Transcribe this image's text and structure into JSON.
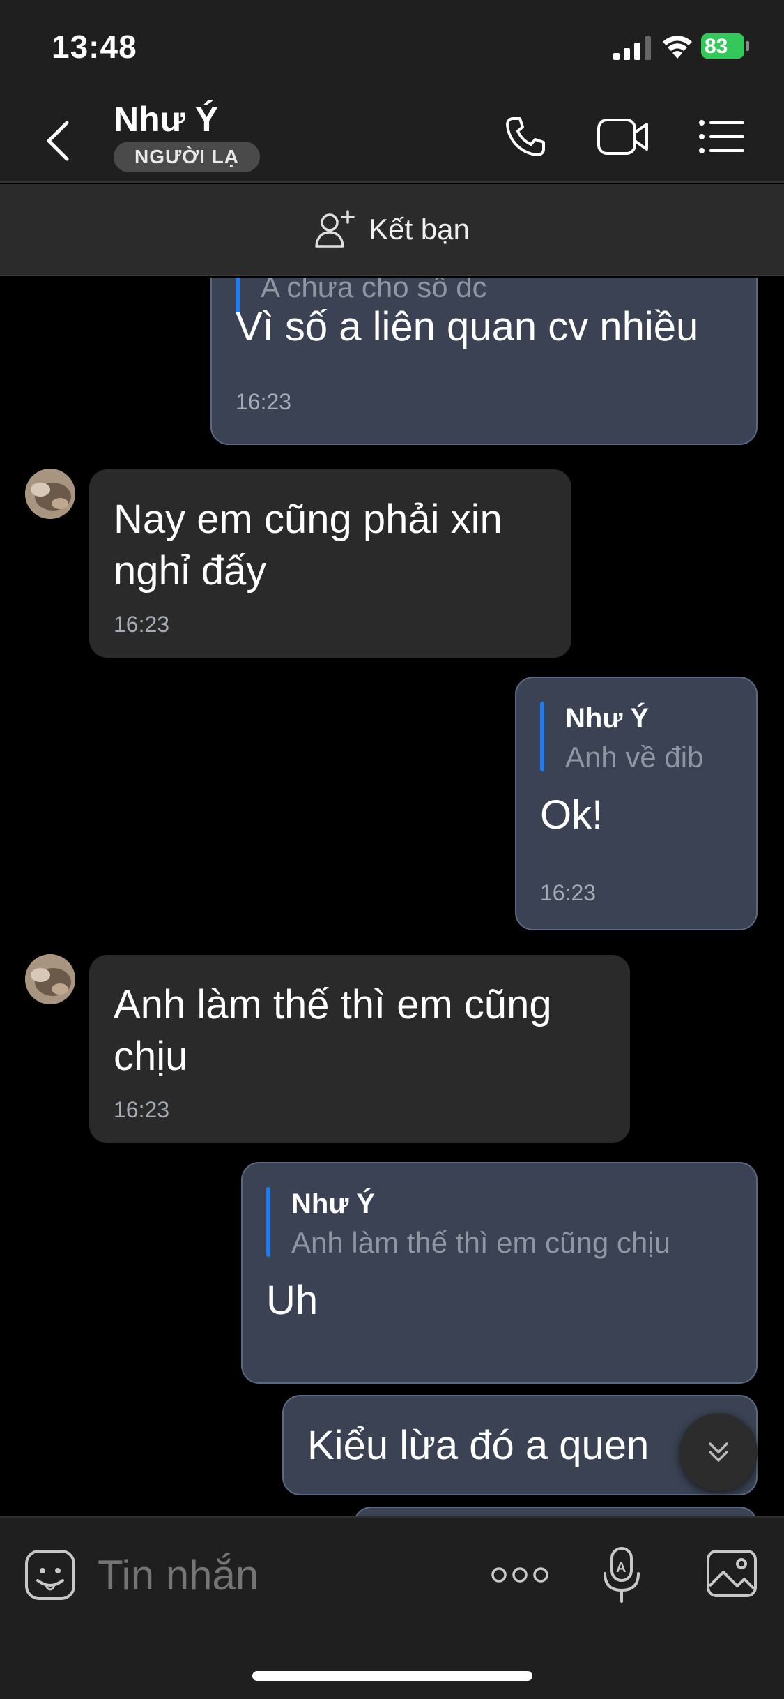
{
  "status_bar": {
    "time": "13:48",
    "battery": "83"
  },
  "header": {
    "contact_name": "Như Ý",
    "badge": "NGƯỜI LẠ"
  },
  "add_friend": {
    "label": "Kết bạn"
  },
  "messages": [
    {
      "type": "sent",
      "quote_text": "A chưa cho số dc",
      "text": "Vì số a liên quan cv nhiều",
      "time": "16:23"
    },
    {
      "type": "received",
      "text_line1": "Nay em cũng phải xin",
      "text_line2": "nghỉ đấy",
      "time": "16:23"
    },
    {
      "type": "sent",
      "quote_name": "Như Ý",
      "quote_text": "Anh về đib",
      "text": "Ok!",
      "time": "16:23"
    },
    {
      "type": "received",
      "text_line1": "Anh làm thế thì em cũng",
      "text_line2": "chịu",
      "time": "16:23"
    },
    {
      "type": "sent",
      "quote_name": "Như Ý",
      "quote_text": "Anh làm thế thì em cũng chịu",
      "text": "Uh"
    },
    {
      "type": "sent",
      "text": "Kiểu lừa đó a quen"
    }
  ],
  "composer": {
    "placeholder": "Tin nhắn"
  },
  "colors": {
    "sent_bubble": "#3a4253",
    "received_bubble": "#2a2a2a",
    "quote_accent": "#1f7bf0",
    "battery": "#34c759"
  }
}
